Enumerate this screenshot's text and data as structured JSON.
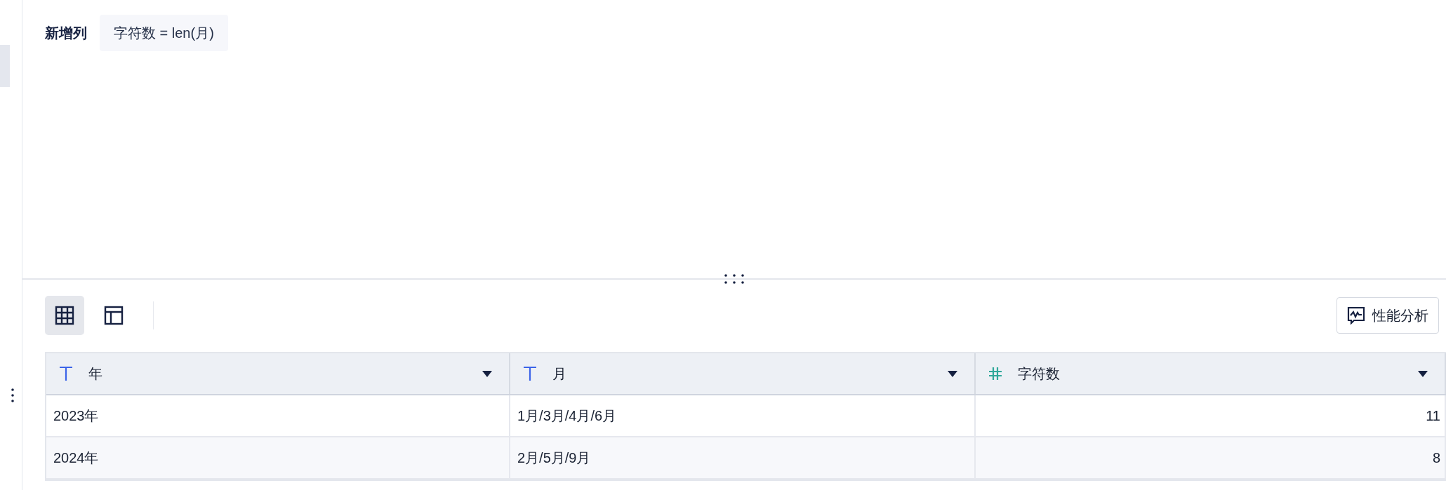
{
  "new_column": {
    "label": "新增列",
    "formula": "字符数 = len(月)"
  },
  "view_buttons": [
    {
      "kind": "table",
      "selected": true
    },
    {
      "kind": "layout",
      "selected": false
    }
  ],
  "perf_button": {
    "label": "性能分析"
  },
  "table": {
    "columns": [
      {
        "kind": "text",
        "label": "年"
      },
      {
        "kind": "text",
        "label": "月"
      },
      {
        "kind": "number",
        "label": "字符数"
      }
    ],
    "rows": [
      [
        "2023年",
        "1月/3月/4月/6月",
        "11"
      ],
      [
        "2024年",
        "2月/5月/9月",
        "8"
      ]
    ]
  }
}
